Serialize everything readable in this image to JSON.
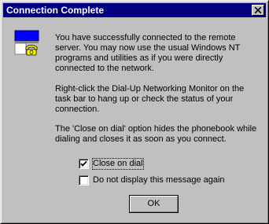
{
  "window": {
    "title": "Connection Complete",
    "titlebar_color": "#000080"
  },
  "icons": {
    "close": "close-icon",
    "connection": "dialup-connection-icon"
  },
  "message": {
    "para1": "You have successfully connected to the remote server.  You may now use the usual Windows NT programs and utilities as if you were directly connected to the network.",
    "para2": "Right-click the Dial-Up Networking Monitor on the task bar to hang up or check the status of your connection.",
    "para3": "The 'Close on dial' option hides the phonebook while dialing and closes it as soon as you connect."
  },
  "options": {
    "close_on_dial": {
      "label": "Close on dial",
      "checked": true
    },
    "do_not_display": {
      "label": "Do not display this message again",
      "checked": false
    }
  },
  "buttons": {
    "ok_label": "OK"
  }
}
